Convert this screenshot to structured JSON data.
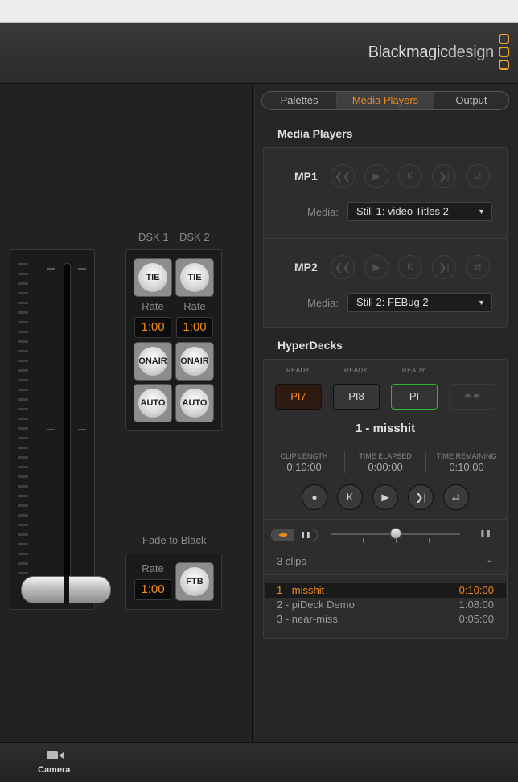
{
  "brand": {
    "part1": "Blackmagic",
    "part2": "design"
  },
  "tabs": [
    "Palettes",
    "Media Players",
    "Output"
  ],
  "dsk": {
    "labels": [
      "DSK 1",
      "DSK 2"
    ],
    "tie_label": "TIE",
    "rate_label": "Rate",
    "rates": [
      "1:00",
      "1:00"
    ],
    "on_air_line1": "ON",
    "on_air_line2": "AIR",
    "auto_label": "AUTO"
  },
  "ftb": {
    "title": "Fade to Black",
    "rate_label": "Rate",
    "rate": "1:00",
    "button": "FTB"
  },
  "media_players": {
    "title": "Media Players",
    "media_label": "Media:",
    "players": [
      {
        "name": "MP1",
        "media": "Still 1: video Titles 2"
      },
      {
        "name": "MP2",
        "media": "Still 2: FEBug 2"
      }
    ]
  },
  "hyperdecks": {
    "title": "HyperDecks",
    "decks": [
      {
        "status": "READY",
        "label": "PI7"
      },
      {
        "status": "READY",
        "label": "PI8"
      },
      {
        "status": "READY",
        "label": "PI"
      }
    ],
    "current_clip": "1 -  misshit",
    "clip_length_label": "CLIP LENGTH",
    "clip_length": "0:10:00",
    "time_elapsed_label": "TIME ELAPSED",
    "time_elapsed": "0:00:00",
    "time_remaining_label": "TIME REMAINING",
    "time_remaining": "0:10:00",
    "clips_count": "3 clips",
    "clips": [
      {
        "name": "1 -  misshit",
        "duration": "0:10:00"
      },
      {
        "name": "2 -  piDeck Demo",
        "duration": "1:08:00"
      },
      {
        "name": "3 -  near-miss",
        "duration": "0:05:00"
      }
    ],
    "jog_position": 0.5
  },
  "footer": {
    "camera_label": "Camera"
  },
  "colors": {
    "accent": "#f08a1c",
    "green": "#2fb52f",
    "logo": "#f5a623"
  }
}
